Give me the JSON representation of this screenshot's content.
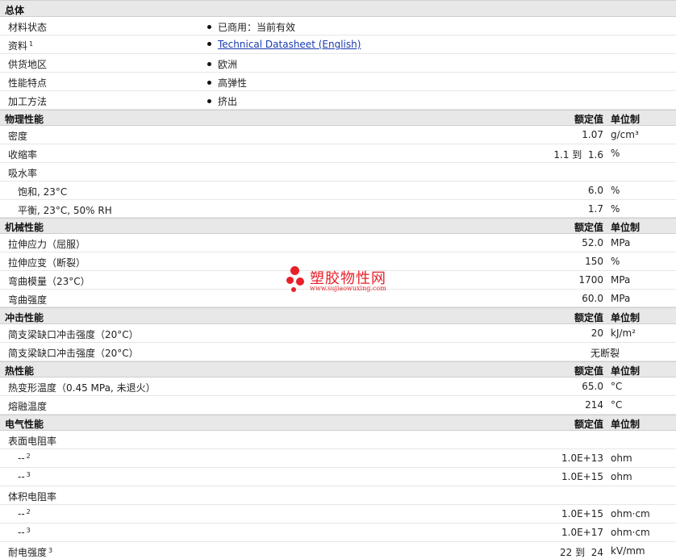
{
  "general": {
    "title": "总体",
    "rows": [
      {
        "label": "材料状态",
        "value": "已商用：当前有效"
      },
      {
        "label": "资料",
        "sup": "1",
        "value": "Technical Datasheet (English)"
      },
      {
        "label": "供货地区",
        "value": "欧洲"
      },
      {
        "label": "性能特点",
        "value": "高弹性"
      },
      {
        "label": "加工方法",
        "value": "挤出"
      }
    ]
  },
  "physical": {
    "title": "物理性能",
    "col_value": "额定值",
    "col_unit": "单位制",
    "density": {
      "label": "密度",
      "value": "1.07",
      "unit": "g/cm³"
    },
    "shrinkage": {
      "label": "收缩率",
      "value": "1.1 到  1.6",
      "unit": "%"
    },
    "water_absorption": {
      "label": "吸水率"
    },
    "saturation": {
      "label": "饱和, 23°C",
      "value": "6.0",
      "unit": "%"
    },
    "equilibrium": {
      "label": "平衡, 23°C, 50% RH",
      "value": "1.7",
      "unit": "%"
    }
  },
  "mechanical": {
    "title": "机械性能",
    "col_value": "额定值",
    "col_unit": "单位制",
    "rows": [
      {
        "label": "拉伸应力（屈服）",
        "value": "52.0",
        "unit": "MPa"
      },
      {
        "label": "拉伸应变（断裂）",
        "value": "150",
        "unit": "%"
      },
      {
        "label": "弯曲模量（23°C）",
        "value": "1700",
        "unit": "MPa"
      },
      {
        "label": "弯曲强度",
        "value": "60.0",
        "unit": "MPa"
      }
    ]
  },
  "impact": {
    "title": "冲击性能",
    "col_value": "额定值",
    "col_unit": "单位制",
    "rows": [
      {
        "label": "简支梁缺口冲击强度（20°C）",
        "value": "20",
        "unit": "kJ/m²"
      },
      {
        "label": "简支梁缺口冲击强度（20°C）",
        "value": "无断裂",
        "unit": ""
      }
    ]
  },
  "thermal": {
    "title": "热性能",
    "col_value": "额定值",
    "col_unit": "单位制",
    "rows": [
      {
        "label": "热变形温度（0.45 MPa, 未退火）",
        "value": "65.0",
        "unit": "°C"
      },
      {
        "label": "熔融温度",
        "value": "214",
        "unit": "°C"
      }
    ]
  },
  "electrical": {
    "title": "电气性能",
    "col_value": "额定值",
    "col_unit": "单位制",
    "surface_resistivity": {
      "label": "表面电阻率"
    },
    "sr1": {
      "label": "--",
      "sup": "2",
      "value": "1.0E+13",
      "unit": "ohm"
    },
    "sr2": {
      "label": "--",
      "sup": "3",
      "value": "1.0E+15",
      "unit": "ohm"
    },
    "volume_resistivity": {
      "label": "体积电阻率"
    },
    "vr1": {
      "label": "--",
      "sup": "2",
      "value": "1.0E+15",
      "unit": "ohm·cm"
    },
    "vr2": {
      "label": "--",
      "sup": "3",
      "value": "1.0E+17",
      "unit": "ohm·cm"
    },
    "dielectric": {
      "label": "耐电强度",
      "sup": "3",
      "value": "22 到  24",
      "unit": "kV/mm"
    }
  },
  "watermark": {
    "name": "塑胶物性网",
    "url": "www.sujiaowuxing.com"
  },
  "colors": {
    "section_bg": "#e8e8e8",
    "link": "#1a3bb0",
    "watermark": "#e8202a"
  }
}
